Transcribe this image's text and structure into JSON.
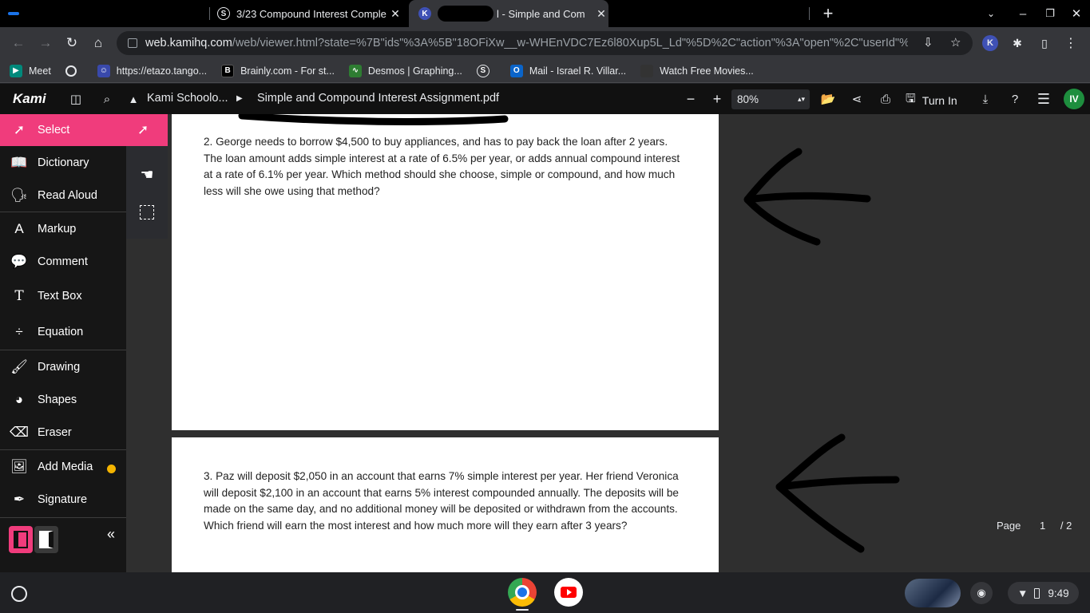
{
  "tabs": [
    {
      "title": "3/23 Compound Interest Comple",
      "icon": "s-icon",
      "active": false
    },
    {
      "title": "l - Simple and Com",
      "icon": "kami-k-icon",
      "active": true
    }
  ],
  "address": {
    "host": "web.kamihq.com",
    "path": "/web/viewer.html?state=%7B\"ids\"%3A%5B\"18OFiXw__w-WHEnVDC7Ez6l80Xup5L_Ld\"%5D%2C\"action\"%3A\"open\"%2C\"userId\"%3..."
  },
  "bookmarks": [
    {
      "label": "Meet",
      "icon": "meet-icon",
      "color": "#00897b"
    },
    {
      "label": "",
      "icon": "globe-icon",
      "color": "#35363a"
    },
    {
      "label": "https://etazo.tango...",
      "icon": "tango-icon",
      "color": "#3949ab"
    },
    {
      "label": "Brainly.com - For st...",
      "icon": "brainly-icon",
      "color": "#000000"
    },
    {
      "label": "Desmos | Graphing...",
      "icon": "desmos-icon",
      "color": "#2e7d32"
    },
    {
      "label": "",
      "icon": "s-icon",
      "color": "#35363a"
    },
    {
      "label": "Mail - Israel R. Villar...",
      "icon": "outlook-icon",
      "color": "#0a64c9"
    },
    {
      "label": "Watch Free Movies...",
      "icon": "movies-icon",
      "color": "#333333"
    }
  ],
  "kami": {
    "logo": "Kami",
    "breadcrumb_parent": "Kami Schoolo...",
    "file_name": "Simple and Compound Interest Assignment.pdf",
    "zoom": "80%",
    "turn_in": "Turn In",
    "avatar": "IV"
  },
  "sidebar": {
    "items": [
      {
        "label": "Select",
        "icon": "cursor-arrow-icon"
      },
      {
        "label": "Dictionary",
        "icon": "book-icon"
      },
      {
        "label": "Read Aloud",
        "icon": "read-aloud-icon"
      },
      {
        "label": "Markup",
        "icon": "markup-icon"
      },
      {
        "label": "Comment",
        "icon": "comment-icon"
      },
      {
        "label": "Text Box",
        "icon": "text-t-icon"
      },
      {
        "label": "Equation",
        "icon": "divide-icon"
      },
      {
        "label": "Drawing",
        "icon": "brush-icon"
      },
      {
        "label": "Shapes",
        "icon": "shapes-icon"
      },
      {
        "label": "Eraser",
        "icon": "eraser-icon"
      },
      {
        "label": "Add Media",
        "icon": "image-icon"
      },
      {
        "label": "Signature",
        "icon": "pen-nib-icon"
      }
    ]
  },
  "document": {
    "question2": "2. George needs to borrow $4,500 to buy appliances, and has to pay back the loan after 2 years. The loan amount adds simple interest at a rate of 6.5% per year, or adds annual compound interest at a rate of 6.1% per year. Which method should she choose, simple or compound, and how much less will she owe using that method?",
    "question3": "3. Paz will deposit $2,050 in an account that earns 7% simple interest per year. Her friend Veronica will deposit $2,100 in an account that earns 5% interest compounded annually. The deposits will be made on the same day, and no additional money will be deposited or withdrawn from the accounts. Which friend will earn the most interest and how much more will they earn after 3 years?"
  },
  "pagination": {
    "label": "Page",
    "current": "1",
    "total": "/ 2"
  },
  "shelf": {
    "time": "9:49"
  },
  "colors": {
    "accent": "#f03c7c",
    "sidebar_bg": "#161616",
    "canvas_bg": "#2f2f2f"
  }
}
